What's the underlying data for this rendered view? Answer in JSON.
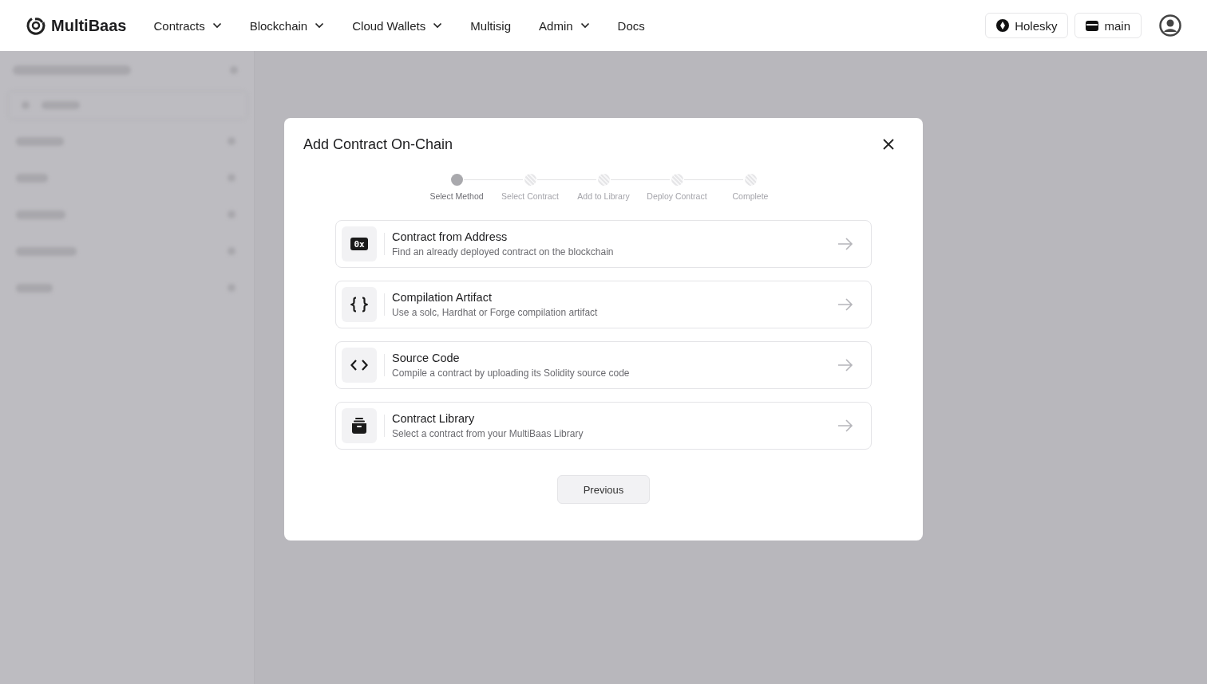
{
  "header": {
    "logo": "MultiBaas",
    "nav": [
      {
        "label": "Contracts",
        "dropdown": true
      },
      {
        "label": "Blockchain",
        "dropdown": true
      },
      {
        "label": "Cloud Wallets",
        "dropdown": true
      },
      {
        "label": "Multisig",
        "dropdown": false
      },
      {
        "label": "Admin",
        "dropdown": true
      },
      {
        "label": "Docs",
        "dropdown": false
      }
    ],
    "network": "Holesky",
    "wallet": "main"
  },
  "dialog": {
    "title": "Add Contract On-Chain",
    "steps": [
      {
        "label": "Select Method",
        "selected": true
      },
      {
        "label": "Select Contract",
        "selected": false
      },
      {
        "label": "Add to Library",
        "selected": false
      },
      {
        "label": "Deploy Contract",
        "selected": false
      },
      {
        "label": "Complete",
        "selected": false
      }
    ],
    "options": [
      {
        "kind": "address",
        "icon_text": "0x",
        "title": "Contract from Address",
        "description": "Find an already deployed contract on the blockchain"
      },
      {
        "kind": "artifact",
        "title": "Compilation Artifact",
        "description": "Use a solc, Hardhat or Forge compilation artifact"
      },
      {
        "kind": "source",
        "title": "Source Code",
        "description": "Compile a contract by uploading its Solidity source code"
      },
      {
        "kind": "library",
        "title": "Contract Library",
        "description": "Select a contract from your MultiBaas Library"
      }
    ],
    "previous_button": "Previous"
  }
}
